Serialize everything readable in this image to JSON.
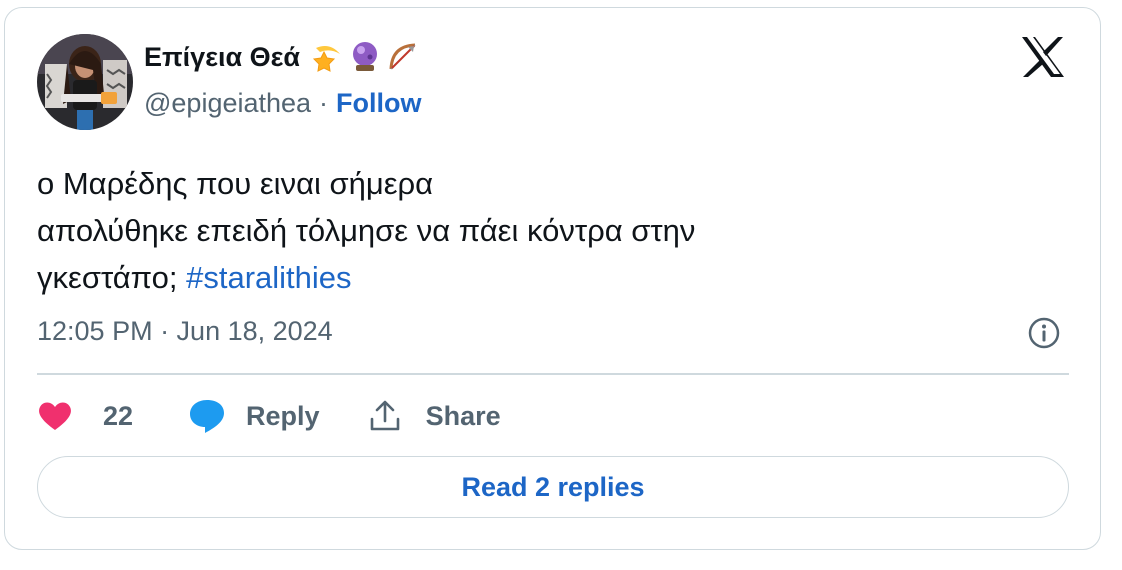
{
  "author": {
    "display_name": "Επίγεια Θεά",
    "emoji_icons": [
      "dizzy-star-icon",
      "crystal-ball-icon",
      "bow-and-arrow-icon"
    ],
    "handle": "@epigeiathea",
    "separator": "·",
    "follow_label": "Follow"
  },
  "tweet": {
    "lines": [
      "ο Μαρέδης που ειναι σήμερα",
      "απολύθηκε επειδή τόλμησε να πάει κόντρα στην"
    ],
    "last_line_text": "γκεστάπο; ",
    "hashtag": "#staralithies",
    "timestamp": "12:05 PM · Jun 18, 2024"
  },
  "actions": {
    "like_count": "22",
    "reply_label": "Reply",
    "share_label": "Share"
  },
  "read_replies_label": "Read 2 replies",
  "colors": {
    "link": "#1d66c6",
    "muted": "#536471",
    "heart": "#f0306e",
    "reply_bubble": "#1d9bf0",
    "border": "#cfd9de"
  }
}
